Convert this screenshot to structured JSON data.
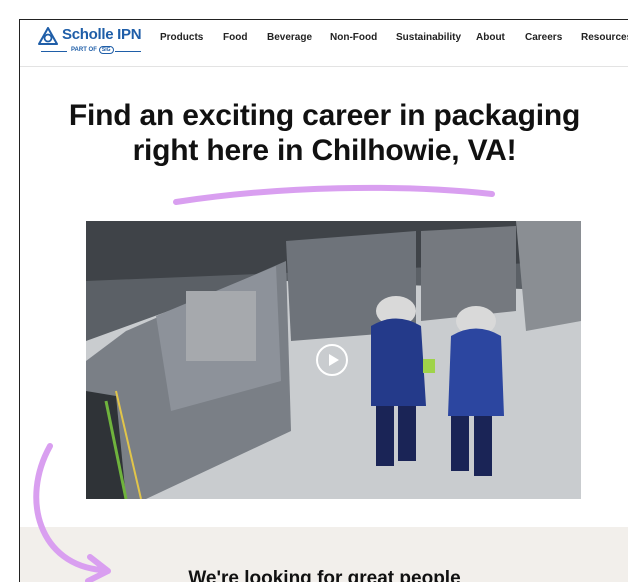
{
  "brand": {
    "name": "Scholle IPN",
    "tagline_prefix": "PART OF",
    "tagline_badge": "SIG",
    "color": "#1f5ea8"
  },
  "nav": {
    "items": [
      "Products",
      "Food",
      "Beverage",
      "Non-Food",
      "Sustainability",
      "About",
      "Careers",
      "Resources"
    ]
  },
  "hero": {
    "title_line1": "Find an exciting career in packaging",
    "title_line2": "right here in Chilhowie, VA!",
    "accent_color": "#d99ff0"
  },
  "video": {
    "play_icon": "play-circle-icon"
  },
  "section": {
    "title": "We're looking for great people",
    "background": "#f2efeb"
  }
}
